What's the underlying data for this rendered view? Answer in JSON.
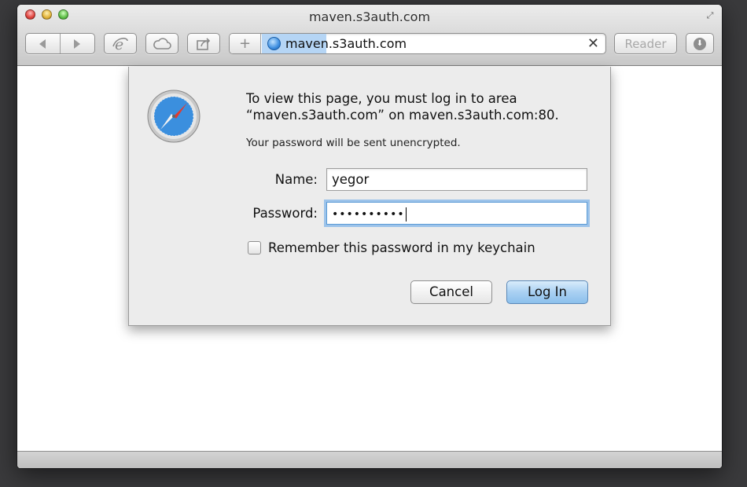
{
  "window": {
    "title": "maven.s3auth.com"
  },
  "toolbar": {
    "plus_label": "+",
    "address": "maven.s3auth.com",
    "clear_label": "✕",
    "reader_label": "Reader"
  },
  "dialog": {
    "message": "To view this page, you must log in to area “maven.s3auth.com” on maven.s3auth.com:80.",
    "warning": "Your password will be sent unencrypted.",
    "name_label": "Name:",
    "name_value": "yegor",
    "password_label": "Password:",
    "password_mask": "••••••••••",
    "remember_label": "Remember this password in my keychain",
    "cancel_label": "Cancel",
    "login_label": "Log In"
  },
  "colors": {
    "accent": "#8cc0ec",
    "focus_ring": "#9cc3ea",
    "address_highlight": "#b5d5f5"
  },
  "icons": [
    "back-icon",
    "forward-icon",
    "internet-explorer-icon",
    "icloud-icon",
    "share-icon",
    "globe-icon",
    "download-icon",
    "safari-compass-icon",
    "fullscreen-icon"
  ]
}
